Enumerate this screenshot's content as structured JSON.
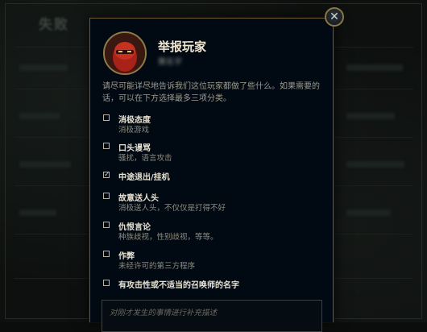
{
  "background": {
    "title": "失败"
  },
  "modal": {
    "title": "举报玩家",
    "player_name": "赛名字",
    "instructions": "请尽可能详尽地告诉我们这位玩家都做了些什么。如果需要的话，可以在下方选择最多三项分类。",
    "close_symbol": "✕",
    "options": [
      {
        "title": "消极态度",
        "desc": "消极游戏",
        "checked": false
      },
      {
        "title": "口头谩骂",
        "desc": "骚扰，语言攻击",
        "checked": false
      },
      {
        "title": "中途退出/挂机",
        "desc": "",
        "checked": true
      },
      {
        "title": "故意送人头",
        "desc": "消极送人头，不仅仅是打得不好",
        "checked": false
      },
      {
        "title": "仇恨言论",
        "desc": "种族歧视，性别歧视，等等。",
        "checked": false
      },
      {
        "title": "作弊",
        "desc": "未经许可的第三方程序",
        "checked": false
      },
      {
        "title": "有攻击性或不适当的召唤师的名字",
        "desc": "",
        "checked": false
      }
    ],
    "comment_placeholder": "对刚才发生的事情进行补充描述"
  },
  "colors": {
    "accent_gold": "#8a7748",
    "panel_bg": "#010a13"
  },
  "icons": {
    "close": "close-icon",
    "avatar": "champion-avatar",
    "checkmark": "checkmark-icon"
  }
}
